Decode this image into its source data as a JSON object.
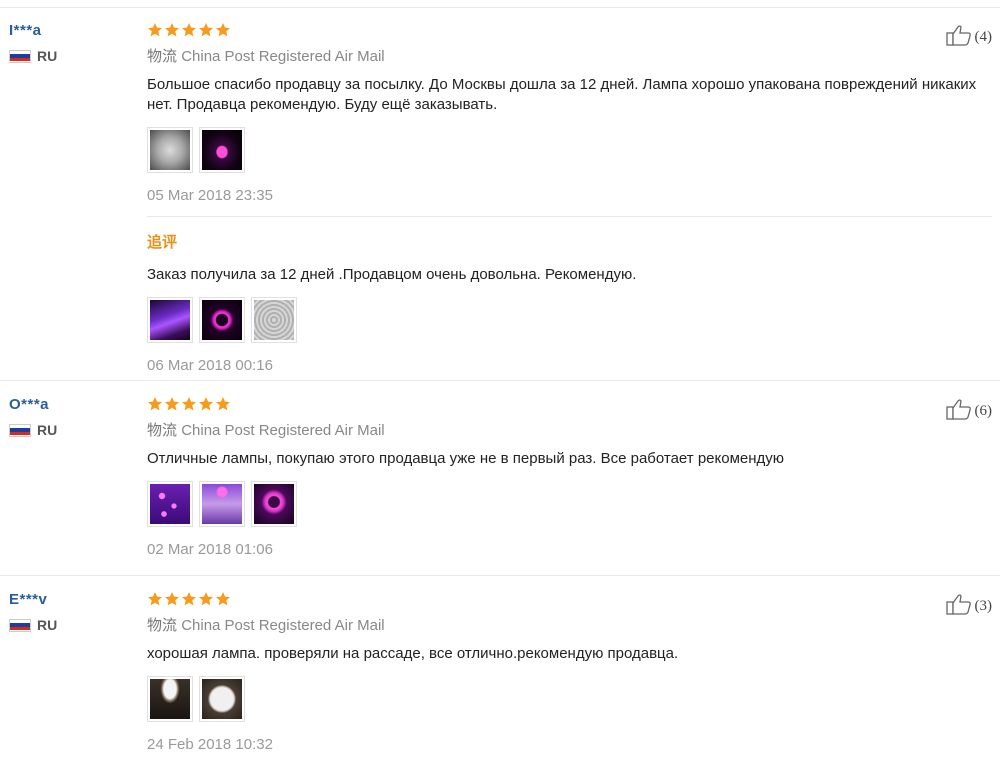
{
  "shipping_label_prefix": "物流",
  "reviews": [
    {
      "user": "I***a",
      "country": "RU",
      "rating": 5,
      "shipping": "China Post Registered Air Mail",
      "text": "Большое спасибо продавцу за посылку. До Москвы дошла за 12 дней. Лампа хорошо упакована повреждений никаких нет. Продавца рекомендую. Буду ещё заказывать.",
      "photos": [
        "ph-metal",
        "ph-pink"
      ],
      "date": "05 Mar 2018 23:35",
      "helpful_count": "(4)",
      "additional": {
        "label": "追评",
        "text": "Заказ получила за 12 дней .Продавцом очень довольна. Рекомендую.",
        "photos": [
          "ph-purple-scene",
          "ph-ring",
          "ph-metal2"
        ],
        "date": "06 Mar 2018 00:16"
      }
    },
    {
      "user": "O***a",
      "country": "RU",
      "rating": 5,
      "shipping": "China Post Registered Air Mail",
      "text": "Отличные лампы, покупаю этого продавца уже не в первый раз. Все работает рекомендую",
      "photos": [
        "ph-dots",
        "ph-plant",
        "ph-ring2"
      ],
      "date": "02 Mar 2018 01:06",
      "helpful_count": "(6)"
    },
    {
      "user": "E***v",
      "country": "RU",
      "rating": 5,
      "shipping": "China Post Registered Air Mail",
      "text": "хорошая лампа. проверяли на рассаде, все отлично.рекомендую продавца.",
      "photos": [
        "ph-cone",
        "ph-disc"
      ],
      "date": "24 Feb 2018 10:32",
      "helpful_count": "(3)"
    }
  ],
  "colors": {
    "star": "#f79b1c",
    "username": "#2a5d99",
    "followup_label": "#e8911f",
    "flag_white": "#ffffff",
    "flag_blue": "#1c3f9e",
    "flag_red": "#d52b1e"
  },
  "icons": {
    "rating": "star-icon",
    "helpful": "thumbs-up-icon",
    "country": "russia-flag-icon"
  }
}
